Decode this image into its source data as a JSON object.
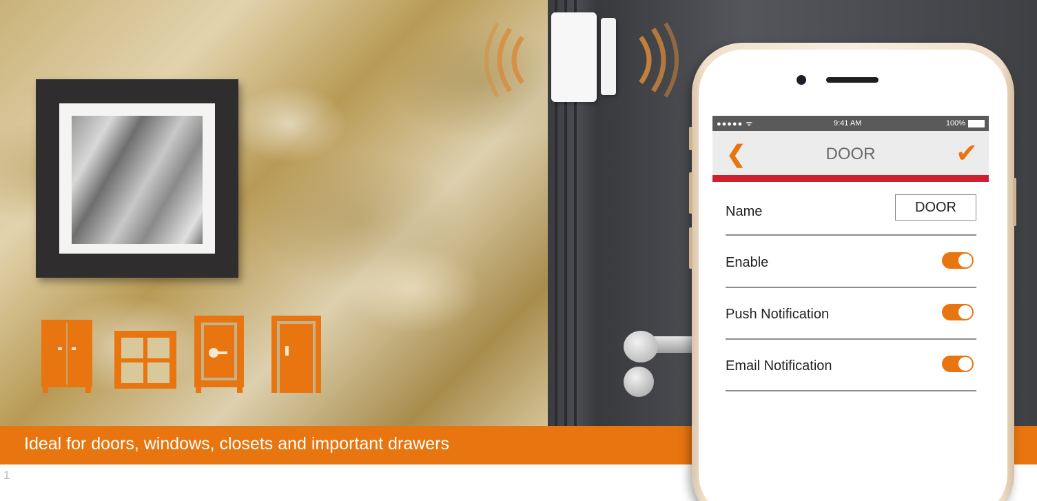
{
  "banner": {
    "text": "Ideal for doors, windows, closets and important drawers"
  },
  "page_number": "1",
  "phone": {
    "status_bar": {
      "signal": "●●●●● ᯤ",
      "time": "9:41 AM",
      "battery": "100%"
    },
    "nav": {
      "back_glyph": "❮",
      "title": "DOOR",
      "confirm_glyph": "✔"
    },
    "form": {
      "name_label": "Name",
      "name_value": "DOOR",
      "enable_label": "Enable",
      "enable_on": true,
      "push_label": "Push Notification",
      "push_on": true,
      "email_label": "Email Notification",
      "email_on": true
    }
  },
  "colors": {
    "accent": "#e8750f",
    "divider": "#d02030",
    "statusbar": "#5a5a5a"
  },
  "icons": [
    "closet-icon",
    "window-icon",
    "safe-icon",
    "door-icon"
  ]
}
